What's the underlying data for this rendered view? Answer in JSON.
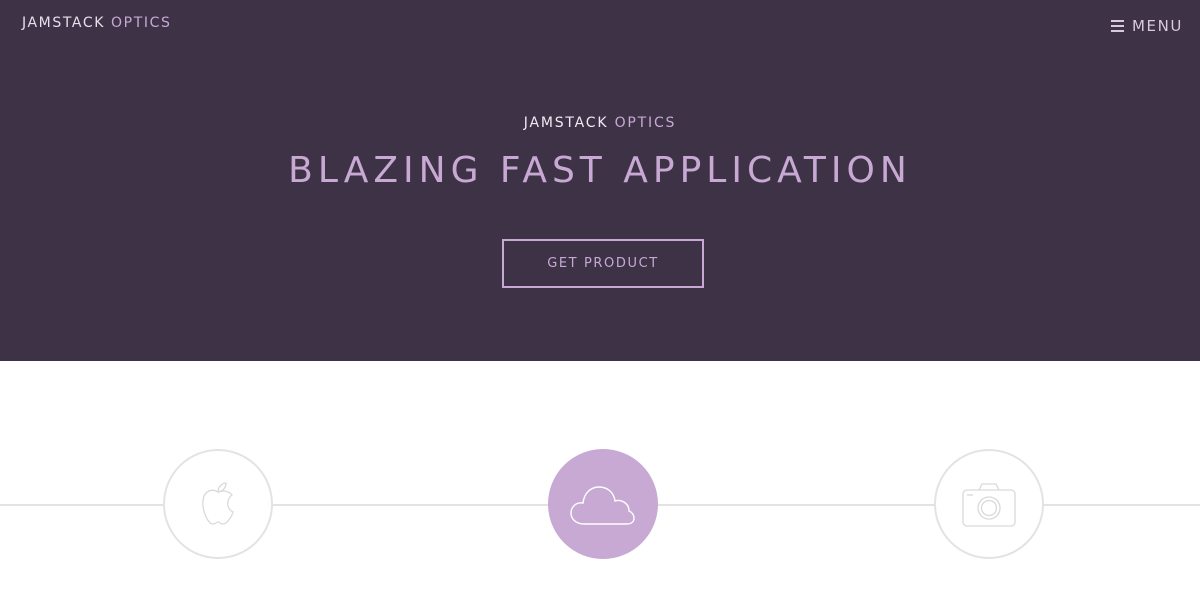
{
  "header": {
    "brand_primary": "JAMSTACK",
    "brand_secondary": "OPTICS",
    "menu_label": "MENU",
    "menu_icon": "hamburger-icon"
  },
  "hero": {
    "kicker_primary": "JAMSTACK",
    "kicker_secondary": "OPTICS",
    "title": "BLAZING FAST APPLICATION",
    "cta_label": "GET PRODUCT"
  },
  "features": {
    "items": [
      {
        "icon": "apple-icon",
        "active": false
      },
      {
        "icon": "cloud-icon",
        "active": true
      },
      {
        "icon": "camera-icon",
        "active": false
      }
    ]
  },
  "colors": {
    "hero_background": "#3d3246",
    "accent": "#c7a9d3",
    "light_text": "#f0eaf3",
    "line": "#e3e3e3",
    "page_background": "#ffffff"
  }
}
